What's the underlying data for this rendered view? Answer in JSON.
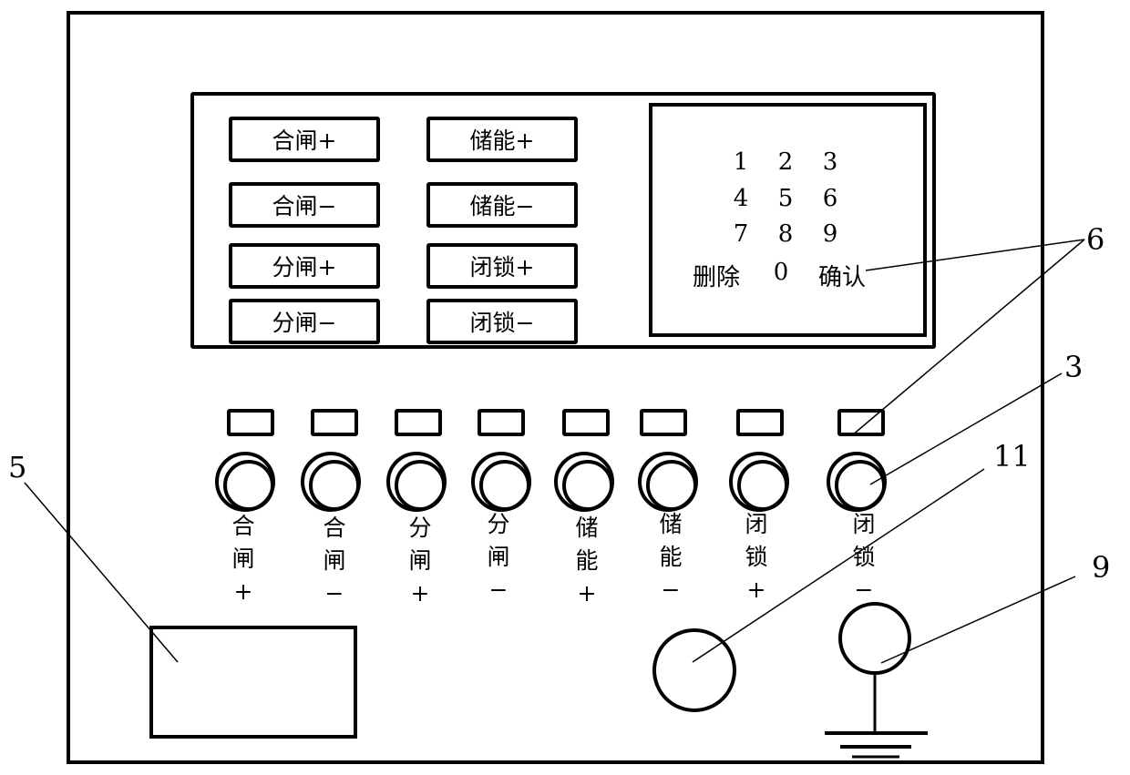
{
  "panel_buttons": [
    {
      "label": "合闸+"
    },
    {
      "label": "合闸−"
    },
    {
      "label": "分闸+"
    },
    {
      "label": "分闸−"
    },
    {
      "label": "储能+"
    },
    {
      "label": "储能−"
    },
    {
      "label": "闭锁+"
    },
    {
      "label": "闭锁−"
    }
  ],
  "keypad": {
    "rows": [
      [
        "1",
        "2",
        "3"
      ],
      [
        "4",
        "5",
        "6"
      ],
      [
        "7",
        "8",
        "9"
      ]
    ],
    "delete_label": "删除",
    "zero_label": "0",
    "confirm_label": "确认"
  },
  "terminals": [
    {
      "line1": "合",
      "line2": "闸",
      "sign": "+"
    },
    {
      "line1": "合",
      "line2": "闸",
      "sign": "−"
    },
    {
      "line1": "分",
      "line2": "闸",
      "sign": "+"
    },
    {
      "line1": "分",
      "line2": "闸",
      "sign": "−"
    },
    {
      "line1": "储",
      "line2": "能",
      "sign": "+"
    },
    {
      "line1": "储",
      "line2": "能",
      "sign": "−"
    },
    {
      "line1": "闭",
      "line2": "锁",
      "sign": "+"
    },
    {
      "line1": "闭",
      "line2": "锁",
      "sign": "−"
    }
  ],
  "callouts": {
    "c6": "6",
    "c3": "3",
    "c11": "11",
    "c9": "9",
    "c5": "5"
  }
}
